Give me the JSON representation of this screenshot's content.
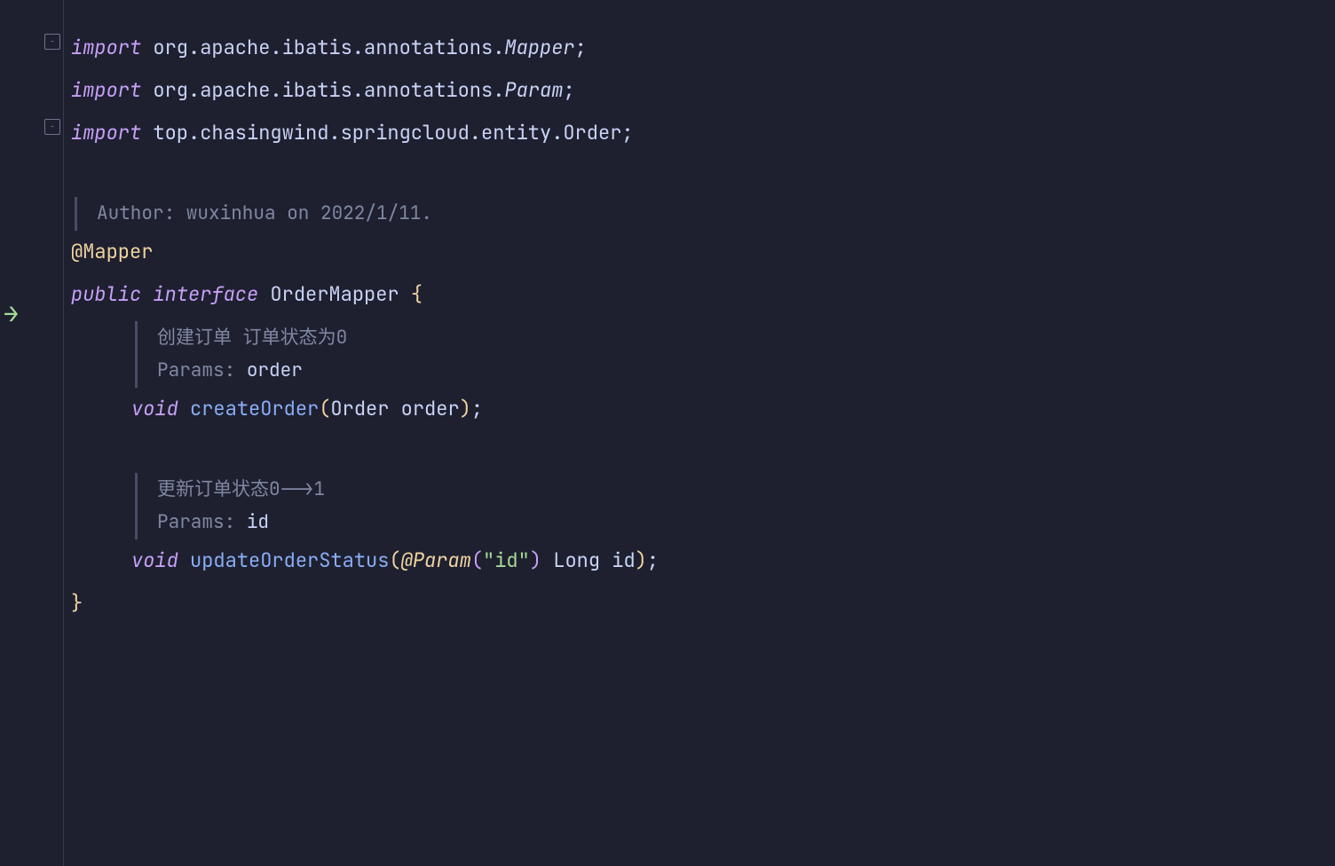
{
  "code": {
    "line1": {
      "keyword": "import",
      "space": " ",
      "package": "org.apache.ibatis.annotations.",
      "class": "Mapper",
      "semi": ";"
    },
    "line2": {
      "keyword": "import",
      "space": " ",
      "package": "org.apache.ibatis.annotations.",
      "class": "Param",
      "semi": ";"
    },
    "line3": {
      "keyword": "import",
      "space": " ",
      "package": "top.chasingwind.springcloud.entity.Order;",
      "semi": ""
    },
    "author_comment": "Author: wuxinhua on 2022/1/11.",
    "annotation": "@Mapper",
    "declaration": {
      "public": "public",
      "space1": " ",
      "interface": "interface",
      "space2": " ",
      "name": "OrderMapper",
      "space3": " ",
      "brace": "{"
    },
    "comment1_line1": "创建订单 订单状态为0",
    "comment1_line2_prefix": "Params: ",
    "comment1_line2_param": "order",
    "method1": {
      "void": "void",
      "space1": " ",
      "name": "createOrder",
      "paren_open": "(",
      "param_type": "Order",
      "space2": " ",
      "param_name": "order",
      "paren_close": ")",
      "semi": ";"
    },
    "comment2_line1": "更新订单状态0-->1",
    "comment2_line2_prefix": "Params: ",
    "comment2_line2_param": "id",
    "method2": {
      "void": "void",
      "space1": " ",
      "name": "updateOrderStatus",
      "paren_open": "(",
      "annotation": "@Param",
      "paren2_open": "(",
      "string": "\"id\"",
      "paren2_close": ")",
      "space2": " ",
      "param_type": "Long",
      "space3": " ",
      "param_name": "id",
      "paren_close": ")",
      "semi": ";"
    },
    "close_brace": "}"
  }
}
